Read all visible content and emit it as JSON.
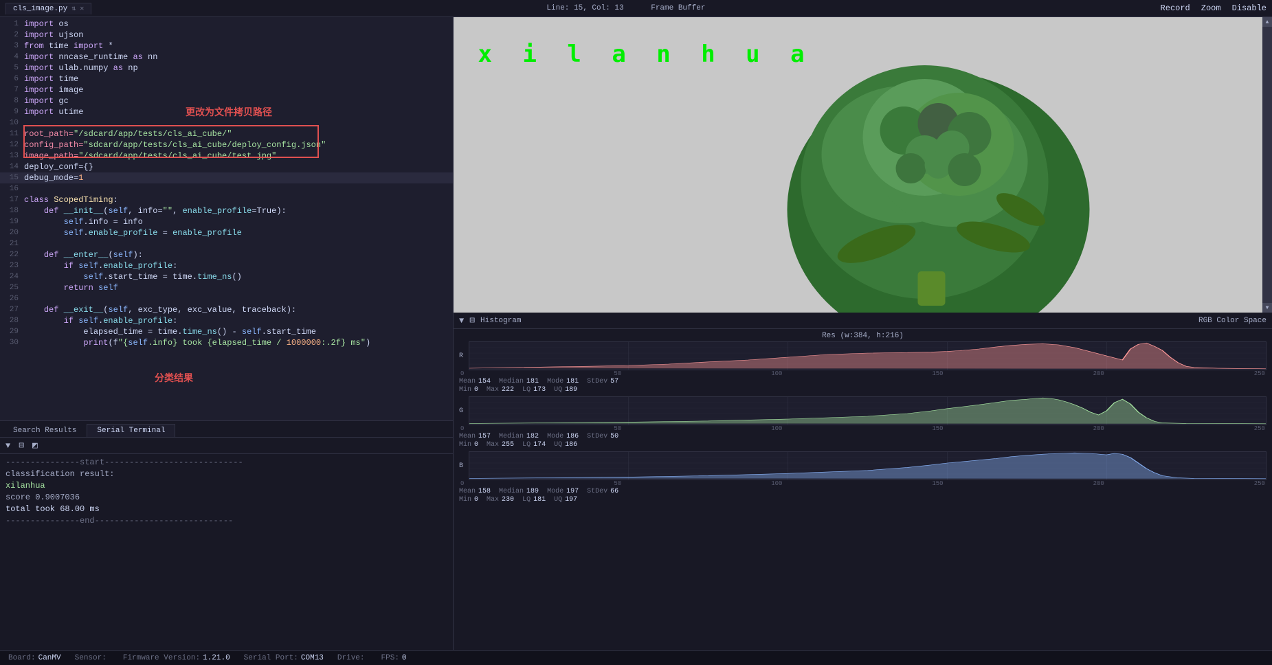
{
  "topbar": {
    "tab_name": "cls_image.py",
    "position": "Line: 15, Col: 13",
    "panel_title": "Frame Buffer",
    "record_btn": "Record",
    "zoom_btn": "Zoom",
    "disable_btn": "Disable"
  },
  "editor": {
    "lines": [
      {
        "num": 1,
        "text": "import os"
      },
      {
        "num": 2,
        "text": "import ujson"
      },
      {
        "num": 3,
        "text": "from time import *"
      },
      {
        "num": 4,
        "text": "import nncase_runtime as nn"
      },
      {
        "num": 5,
        "text": "import ulab.numpy as np"
      },
      {
        "num": 6,
        "text": "import time"
      },
      {
        "num": 7,
        "text": "import image"
      },
      {
        "num": 8,
        "text": "import gc"
      },
      {
        "num": 9,
        "text": "import utime"
      },
      {
        "num": 10,
        "text": ""
      },
      {
        "num": 11,
        "text": "root_path=\"/sdcard/app/tests/cls_ai_cube/\""
      },
      {
        "num": 12,
        "text": "config_path=\"sdcard/app/tests/cls_ai_cube/deploy_config.json\""
      },
      {
        "num": 13,
        "text": "image_path=\"/sdcard/app/tests/cls_ai_cube/test.jpg\""
      },
      {
        "num": 14,
        "text": "deploy_conf={}"
      },
      {
        "num": 15,
        "text": "debug_mode=1"
      },
      {
        "num": 16,
        "text": ""
      },
      {
        "num": 17,
        "text": "class ScopedTiming:"
      },
      {
        "num": 18,
        "text": "    def __init__(self, info=\"\", enable_profile=True):"
      },
      {
        "num": 19,
        "text": "        self.info = info"
      },
      {
        "num": 20,
        "text": "        self.enable_profile = enable_profile"
      },
      {
        "num": 21,
        "text": ""
      },
      {
        "num": 22,
        "text": "    def __enter__(self):"
      },
      {
        "num": 23,
        "text": "        if self.enable_profile:"
      },
      {
        "num": 24,
        "text": "            self.start_time = time.time_ns()"
      },
      {
        "num": 25,
        "text": "        return self"
      },
      {
        "num": 26,
        "text": ""
      },
      {
        "num": 27,
        "text": "    def __exit__(self, exc_type, exc_value, traceback):"
      },
      {
        "num": 28,
        "text": "        if self.enable_profile:"
      },
      {
        "num": 29,
        "text": "            elapsed_time = time.time_ns() - self.start_time"
      },
      {
        "num": 30,
        "text": "            print(f\"{self.info} took {elapsed_time / 1000000:.2f} ms\")"
      }
    ],
    "annotation_path": "更改为文件拷贝路径",
    "annotation_result": "分类结果"
  },
  "terminal": {
    "content": [
      "---------------start----------------------------",
      "classification result:",
      "xilanhua",
      "score 0.9007036",
      "total took 68.00 ms",
      "---------------end----------------------------"
    ]
  },
  "framebuffer": {
    "label": "x i l a n h u a"
  },
  "histogram": {
    "title": "Histogram",
    "colorspace": "RGB Color Space",
    "resolution": "Res (w:384, h:216)",
    "channels": [
      {
        "name": "R",
        "color": "#ff6b6b",
        "peak_position": 0.82,
        "stats": [
          {
            "label": "Mean",
            "value": "154"
          },
          {
            "label": "Median",
            "value": "181"
          },
          {
            "label": "Mode",
            "value": "181"
          },
          {
            "label": "StDev",
            "value": "57"
          }
        ],
        "stats2": [
          {
            "label": "Min",
            "value": "0"
          },
          {
            "label": "Max",
            "value": "222"
          },
          {
            "label": "LQ",
            "value": "173"
          },
          {
            "label": "UQ",
            "value": "189"
          }
        ]
      },
      {
        "name": "G",
        "color": "#a6e3a1",
        "peak_position": 0.8,
        "stats": [
          {
            "label": "Mean",
            "value": "157"
          },
          {
            "label": "Median",
            "value": "182"
          },
          {
            "label": "Mode",
            "value": "186"
          },
          {
            "label": "StDev",
            "value": "50"
          }
        ],
        "stats2": [
          {
            "label": "Min",
            "value": "0"
          },
          {
            "label": "Max",
            "value": "255"
          },
          {
            "label": "LQ",
            "value": "174"
          },
          {
            "label": "UQ",
            "value": "186"
          }
        ]
      },
      {
        "name": "B",
        "color": "#89b4fa",
        "peak_position": 0.82,
        "stats": [
          {
            "label": "Mean",
            "value": "158"
          },
          {
            "label": "Median",
            "value": "189"
          },
          {
            "label": "Mode",
            "value": "197"
          },
          {
            "label": "StDev",
            "value": "66"
          }
        ],
        "stats2": [
          {
            "label": "Min",
            "value": "0"
          },
          {
            "label": "Max",
            "value": "230"
          },
          {
            "label": "LQ",
            "value": "181"
          },
          {
            "label": "UQ",
            "value": "197"
          }
        ]
      }
    ],
    "axis_labels": [
      "0",
      "50",
      "100",
      "150",
      "200",
      "250"
    ]
  },
  "statusbar": {
    "board_label": "Board:",
    "board_val": "CanMV",
    "sensor_label": "Sensor:",
    "sensor_val": "",
    "firmware_label": "Firmware Version:",
    "firmware_val": "1.21.0",
    "serial_label": "Serial Port:",
    "serial_val": "COM13",
    "drive_label": "Drive:",
    "drive_val": "",
    "fps_label": "FPS:",
    "fps_val": "0"
  },
  "bottomtabs": {
    "tab1": "Search Results",
    "tab2": "Serial Terminal"
  }
}
